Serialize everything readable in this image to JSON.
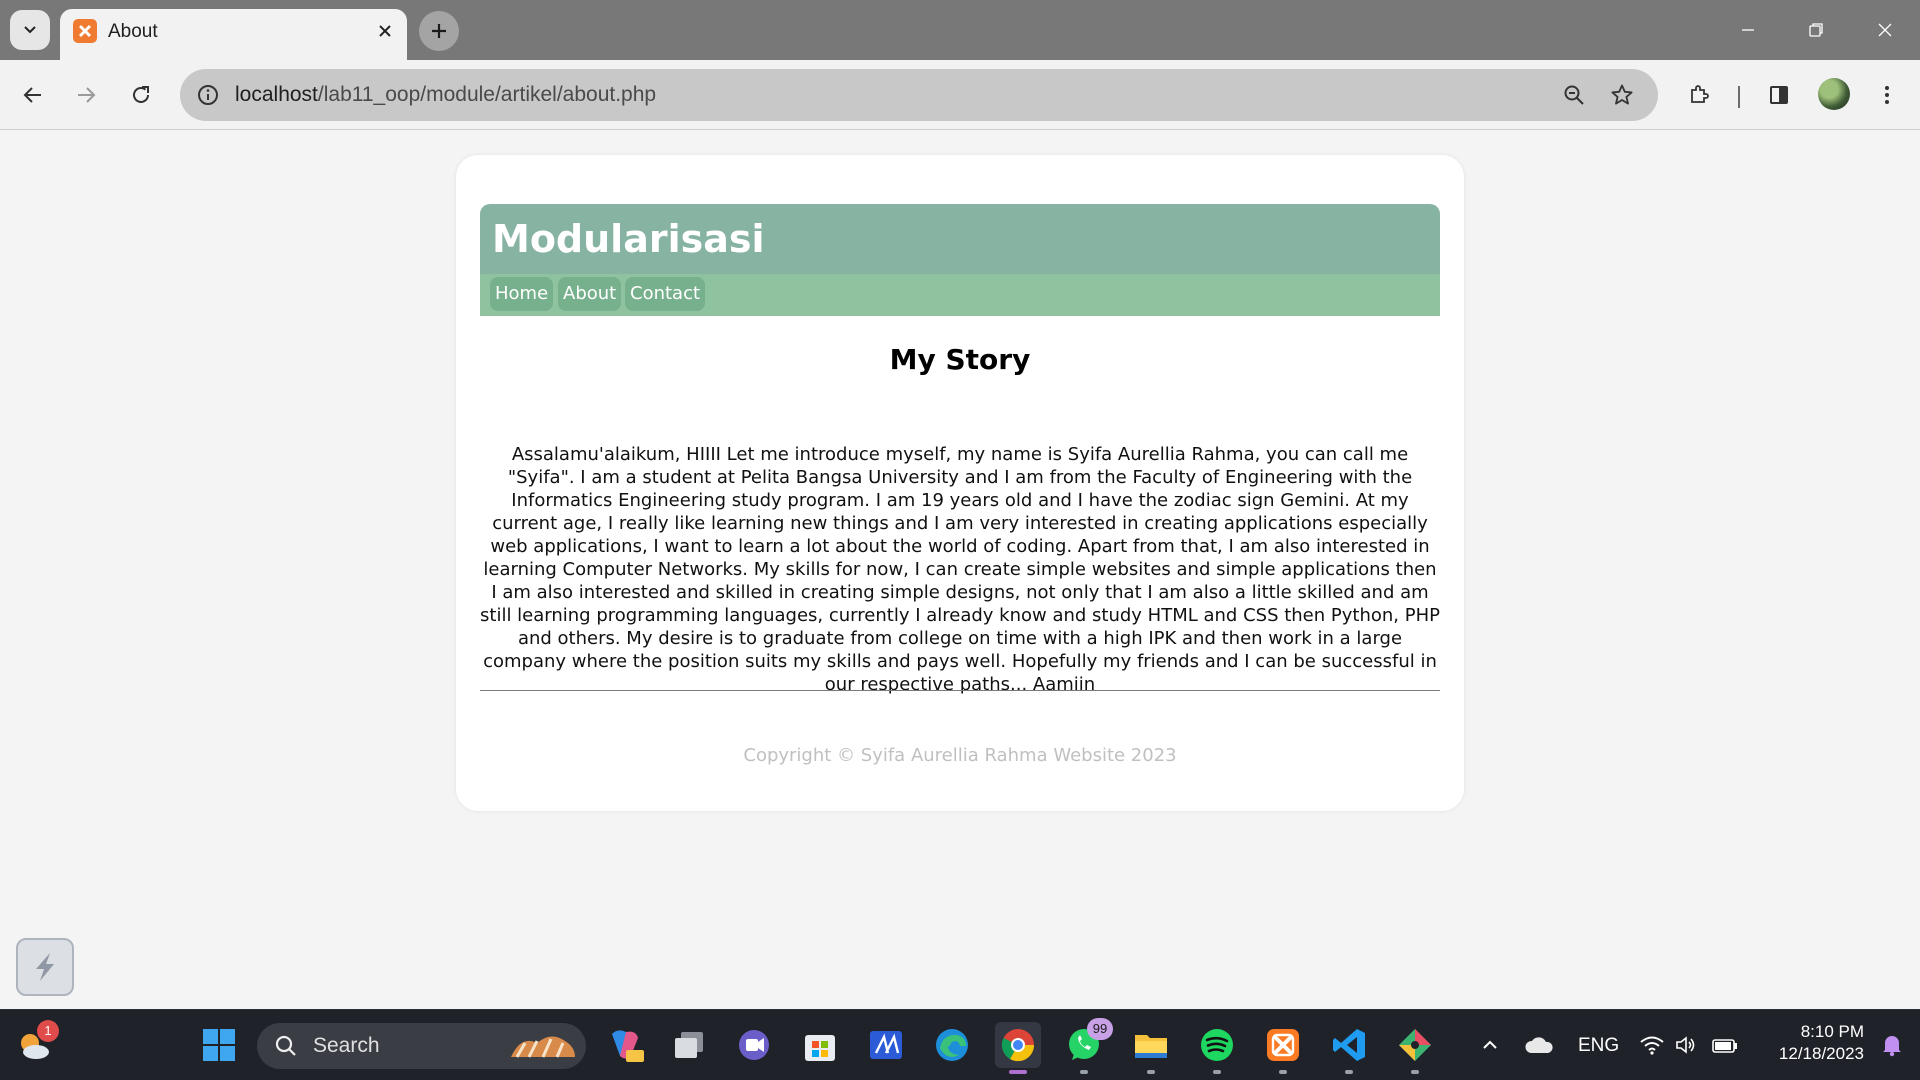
{
  "browser": {
    "tab_title": "About",
    "url_host": "localhost",
    "url_path": "/lab11_oop/module/artikel/about.php"
  },
  "page": {
    "site_title": "Modularisasi",
    "nav": [
      "Home",
      "About",
      "Contact"
    ],
    "heading": "My Story",
    "body": "Assalamu'alaikum, HIIII Let me introduce myself, my name is Syifa Aurellia Rahma, you can call me \"Syifa\". I am a student at Pelita Bangsa University and I am from the Faculty of Engineering with the Informatics Engineering study program. I am 19 years old and I have the zodiac sign Gemini. At my current age, I really like learning new things and I am very interested in creating applications especially web applications, I want to learn a lot about the world of coding. Apart from that, I am also interested in learning Computer Networks. My skills for now, I can create simple websites and simple applications then I am also interested and skilled in creating simple designs, not only that I am also a little skilled and am still learning programming languages, currently I already know and study HTML and CSS then Python, PHP and others. My desire is to graduate from college on time with a high IPK and then work in a large company where the position suits my skills and pays well. Hopefully my friends and I can be successful in our respective paths... Aamiin",
    "copyright": "Copyright © Syifa Aurellia Rahma Website 2023"
  },
  "taskbar": {
    "search_label": "Search",
    "weather_badge": "1",
    "whatsapp_badge": "99",
    "language": "ENG",
    "time": "8:10 PM",
    "date": "12/18/2023"
  },
  "colors": {
    "header_bg": "#87b3a2",
    "nav_bg": "#8fc39f",
    "nav_link_bg": "#77b08c",
    "taskbar_bg": "#1f2229"
  }
}
